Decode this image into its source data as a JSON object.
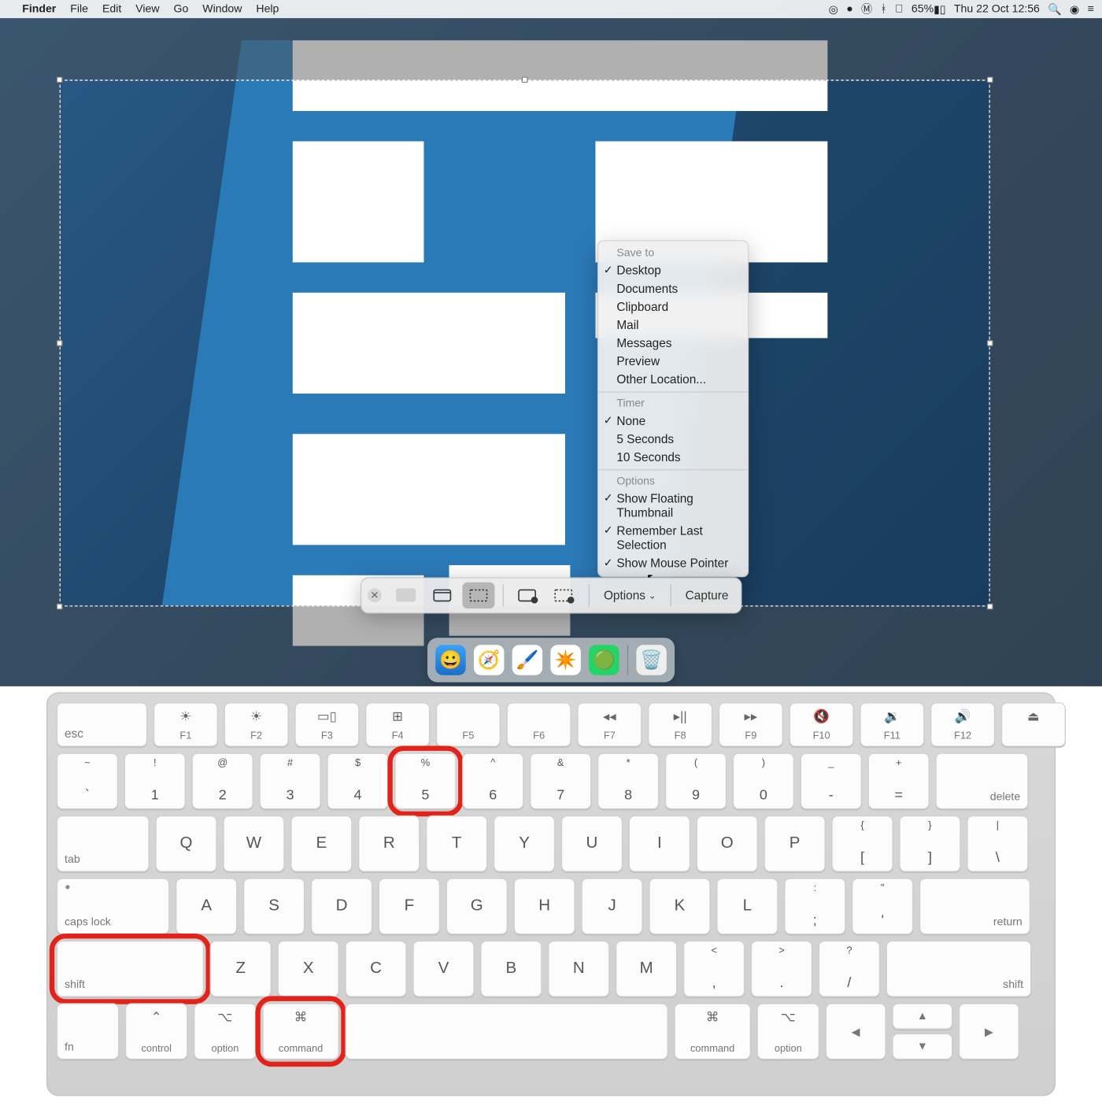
{
  "menubar": {
    "apple": "",
    "appname": "Finder",
    "menus": [
      "File",
      "Edit",
      "View",
      "Go",
      "Window",
      "Help"
    ],
    "status": {
      "battery_pct": "65%",
      "clock": "Thu 22 Oct  12:56"
    }
  },
  "screenshot_toolbar": {
    "options_label": "Options",
    "capture_label": "Capture"
  },
  "options_menu": {
    "sections": [
      {
        "title": "Save to",
        "items": [
          {
            "label": "Desktop",
            "checked": true
          },
          {
            "label": "Documents",
            "checked": false
          },
          {
            "label": "Clipboard",
            "checked": false
          },
          {
            "label": "Mail",
            "checked": false
          },
          {
            "label": "Messages",
            "checked": false
          },
          {
            "label": "Preview",
            "checked": false
          },
          {
            "label": "Other Location...",
            "checked": false
          }
        ]
      },
      {
        "title": "Timer",
        "items": [
          {
            "label": "None",
            "checked": true
          },
          {
            "label": "5 Seconds",
            "checked": false
          },
          {
            "label": "10 Seconds",
            "checked": false
          }
        ]
      },
      {
        "title": "Options",
        "items": [
          {
            "label": "Show Floating Thumbnail",
            "checked": true
          },
          {
            "label": "Remember Last Selection",
            "checked": true
          },
          {
            "label": "Show Mouse Pointer",
            "checked": true
          }
        ]
      }
    ]
  },
  "keyboard": {
    "row_fn": [
      {
        "main": "esc"
      },
      {
        "sym": "☀︎",
        "sub": "F1"
      },
      {
        "sym": "☀",
        "sub": "F2"
      },
      {
        "sym": "▭▯",
        "sub": "F3"
      },
      {
        "sym": "⊞",
        "sub": "F4"
      },
      {
        "sym": "",
        "sub": "F5"
      },
      {
        "sym": "",
        "sub": "F6"
      },
      {
        "sym": "◂◂",
        "sub": "F7"
      },
      {
        "sym": "▸||",
        "sub": "F8"
      },
      {
        "sym": "▸▸",
        "sub": "F9"
      },
      {
        "sym": "🔇",
        "sub": "F10"
      },
      {
        "sym": "🔉",
        "sub": "F11"
      },
      {
        "sym": "🔊",
        "sub": "F12"
      },
      {
        "sym": "⏏"
      }
    ],
    "row_num": [
      {
        "top": "~",
        "bot": "`"
      },
      {
        "top": "!",
        "bot": "1"
      },
      {
        "top": "@",
        "bot": "2"
      },
      {
        "top": "#",
        "bot": "3"
      },
      {
        "top": "$",
        "bot": "4"
      },
      {
        "top": "%",
        "bot": "5",
        "hl": true
      },
      {
        "top": "^",
        "bot": "6"
      },
      {
        "top": "&",
        "bot": "7"
      },
      {
        "top": "*",
        "bot": "8"
      },
      {
        "top": "(",
        "bot": "9"
      },
      {
        "top": ")",
        "bot": "0"
      },
      {
        "top": "_",
        "bot": "-"
      },
      {
        "top": "+",
        "bot": "="
      },
      {
        "label_br": "delete",
        "wide": true
      }
    ],
    "row_q": {
      "lead": {
        "label_bl": "tab",
        "wide": true
      },
      "keys": [
        "Q",
        "W",
        "E",
        "R",
        "T",
        "Y",
        "U",
        "I",
        "O",
        "P"
      ],
      "tail": [
        {
          "top": "{",
          "bot": "["
        },
        {
          "top": "}",
          "bot": "]"
        },
        {
          "top": "|",
          "bot": "\\"
        }
      ]
    },
    "row_a": {
      "lead": {
        "label_bl": "caps lock",
        "wide": true,
        "dot": true
      },
      "keys": [
        "A",
        "S",
        "D",
        "F",
        "G",
        "H",
        "J",
        "K",
        "L"
      ],
      "tail": [
        {
          "top": ":",
          "bot": ";"
        },
        {
          "top": "\"",
          "bot": "'"
        },
        {
          "label_br": "return",
          "wide": true
        }
      ]
    },
    "row_z": {
      "lead": {
        "label_bl": "shift",
        "wide": true,
        "hl": true
      },
      "keys": [
        "Z",
        "X",
        "C",
        "V",
        "B",
        "N",
        "M"
      ],
      "tail": [
        {
          "top": "<",
          "bot": ","
        },
        {
          "top": ">",
          "bot": "."
        },
        {
          "top": "?",
          "bot": "/"
        },
        {
          "label_br": "shift",
          "wide": true
        }
      ]
    },
    "row_mod": [
      {
        "label_bl": "fn"
      },
      {
        "sym": "⌃",
        "label_bc": "control"
      },
      {
        "sym": "⌥",
        "label_bc": "option"
      },
      {
        "sym": "⌘",
        "label_bc": "command",
        "wide": true,
        "hl": true
      },
      {
        "space": true
      },
      {
        "sym": "⌘",
        "label_bc": "command",
        "wide": true
      },
      {
        "sym": "⌥",
        "label_bc": "option"
      },
      {
        "arrow": "◀"
      },
      {
        "arrows_ud": true
      },
      {
        "arrow": "▶"
      }
    ]
  }
}
